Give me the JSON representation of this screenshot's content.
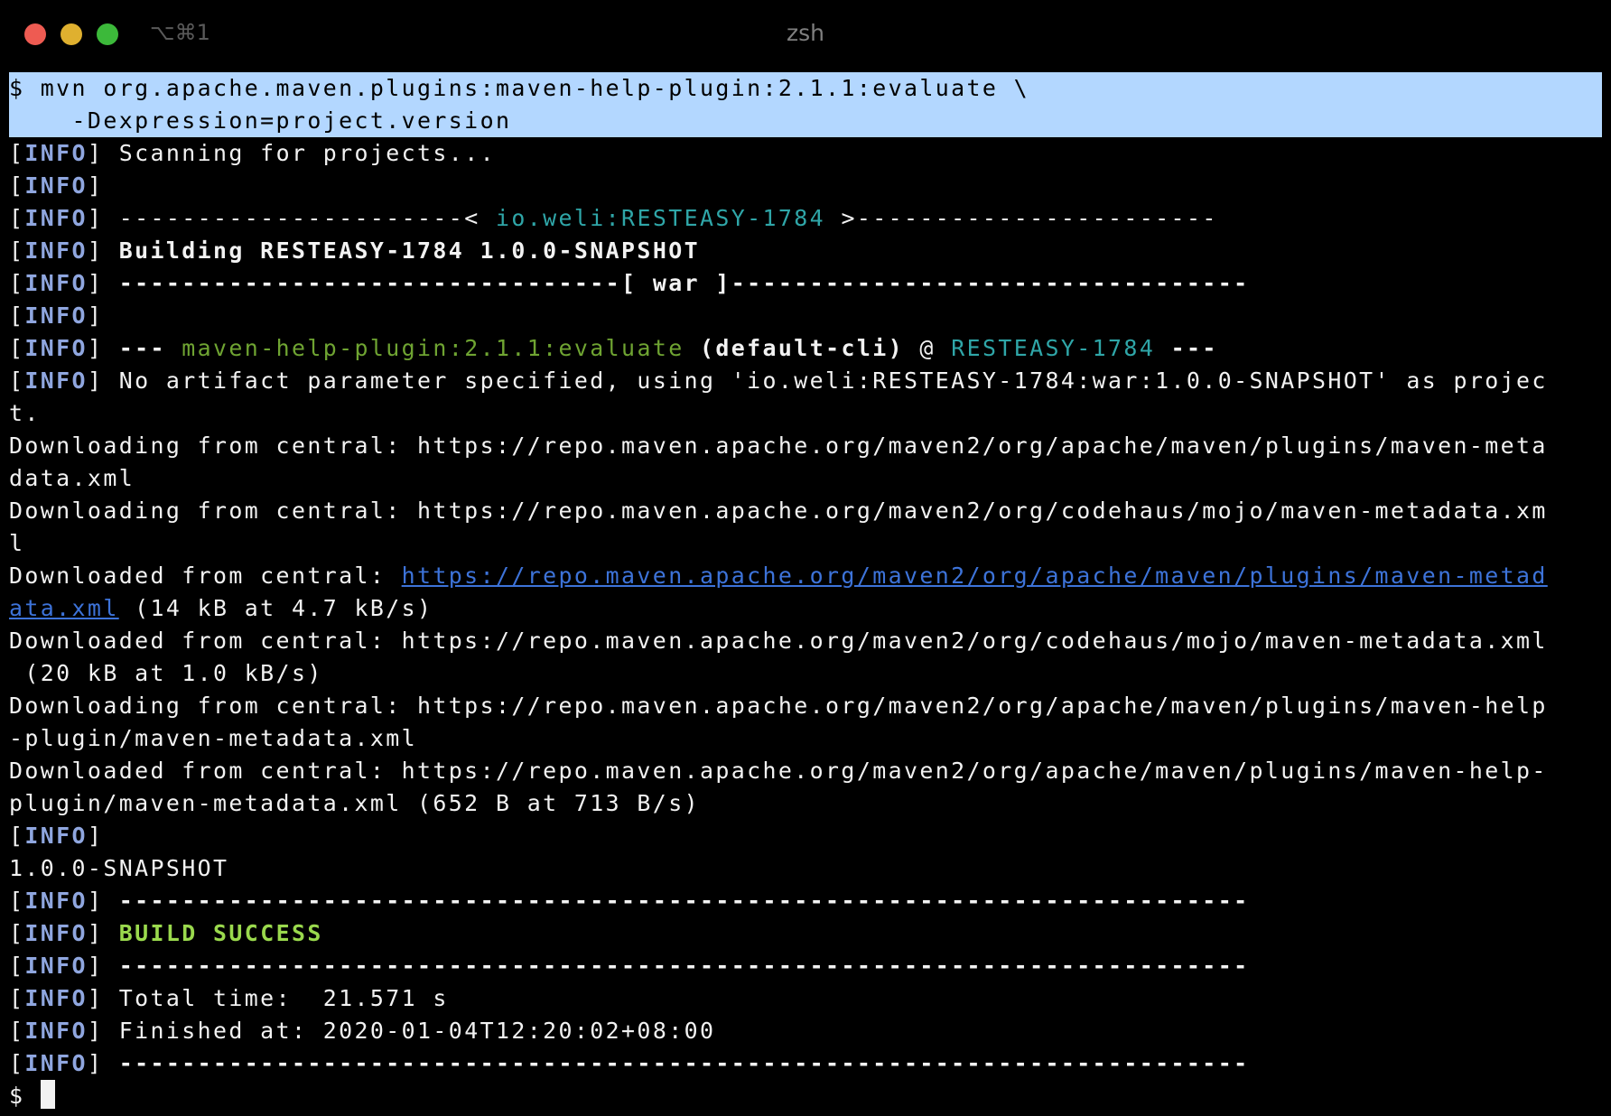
{
  "window": {
    "title": "zsh",
    "shortcut": "⌥⌘1"
  },
  "colors": {
    "selection": "#b3d7ff",
    "info_tag": "#8fa6df",
    "cyan": "#2fa6a8",
    "green": "#6fa432",
    "success": "#9ad94d",
    "link": "#3d73d9",
    "background": "#000000",
    "foreground": "#f2f2f2"
  },
  "terminal": {
    "prompt": "$",
    "cmd_line1": " mvn org.apache.maven.plugins:maven-help-plugin:2.1.1:evaluate \\",
    "cmd_line2": "    -Dexpression=project.version",
    "info_open": "[",
    "info_tag": "INFO",
    "info_close": "]",
    "scanning": " Scanning for projects...",
    "header_left": " ----------------------< ",
    "header_artifact": "io.weli:RESTEASY-1784",
    "header_right": " >-----------------------",
    "building": " Building RESTEASY-1784 1.0.0-SNAPSHOT",
    "war_line": " --------------------------------[ war ]---------------------------------",
    "plugin_prefix": " --- ",
    "plugin_name": "maven-help-plugin:2.1.1:evaluate",
    "plugin_cli": " (default-cli)",
    "plugin_at": " @ ",
    "plugin_project": "RESTEASY-1784",
    "plugin_suffix": " ---",
    "no_artifact_1": " No artifact parameter specified, using 'io.weli:RESTEASY-1784:war:1.0.0-SNAPSHOT' as projec",
    "no_artifact_2": "t.",
    "dl1_a": "Downloading from central: https://repo.maven.apache.org/maven2/org/apache/maven/plugins/maven-meta",
    "dl1_b": "data.xml",
    "dl2_a": "Downloading from central: https://repo.maven.apache.org/maven2/org/codehaus/mojo/maven-metadata.xm",
    "dl2_b": "l",
    "dd1_prefix": "Downloaded from central: ",
    "dd1_link_a": "https://repo.maven.apache.org/maven2/org/apache/maven/plugins/maven-metad",
    "dd1_link_b": "ata.xml",
    "dd1_suffix": " (14 kB at 4.7 kB/s)",
    "dd2_a": "Downloaded from central: https://repo.maven.apache.org/maven2/org/codehaus/mojo/maven-metadata.xml",
    "dd2_b": " (20 kB at 1.0 kB/s)",
    "dl3_a": "Downloading from central: https://repo.maven.apache.org/maven2/org/apache/maven/plugins/maven-help",
    "dl3_b": "-plugin/maven-metadata.xml",
    "dd3_a": "Downloaded from central: https://repo.maven.apache.org/maven2/org/apache/maven/plugins/maven-help-",
    "dd3_b": "plugin/maven-metadata.xml (652 B at 713 B/s)",
    "version_output": "1.0.0-SNAPSHOT",
    "separator": " ------------------------------------------------------------------------",
    "build_success": "BUILD SUCCESS",
    "total_time": " Total time:  21.571 s",
    "finished_at": " Finished at: 2020-01-04T12:20:02+08:00",
    "final_prompt": "$ "
  }
}
